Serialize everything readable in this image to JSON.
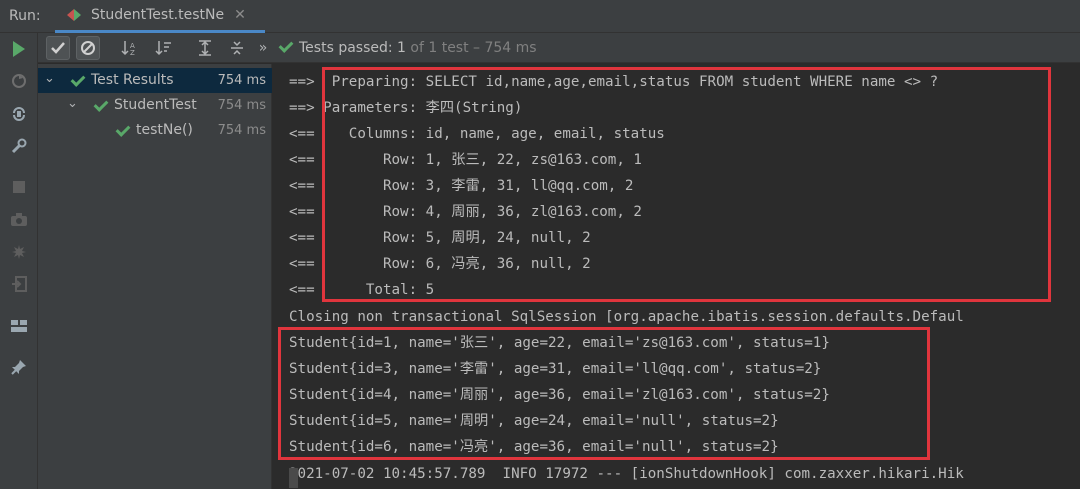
{
  "topbar": {
    "run_label": "Run:",
    "tab_title": "StudentTest.testNe",
    "tab_close": "✕"
  },
  "toolbar": {
    "status_bold": "Tests passed:",
    "status_count": " 1",
    "status_rest": " of 1 test – 754 ms",
    "more": "»"
  },
  "tree": {
    "items": [
      {
        "label": "Test Results",
        "time": "754 ms"
      },
      {
        "label": "StudentTest",
        "time": "754 ms"
      },
      {
        "label": "testNe()",
        "time": "754 ms"
      }
    ]
  },
  "console": {
    "lines": [
      "==>  Preparing: SELECT id,name,age,email,status FROM student WHERE name <> ?",
      "==> Parameters: 李四(String)",
      "<==    Columns: id, name, age, email, status",
      "<==        Row: 1, 张三, 22, zs@163.com, 1",
      "<==        Row: 3, 李雷, 31, ll@qq.com, 2",
      "<==        Row: 4, 周丽, 36, zl@163.com, 2",
      "<==        Row: 5, 周明, 24, null, 2",
      "<==        Row: 6, 冯亮, 36, null, 2",
      "<==      Total: 5",
      "Closing non transactional SqlSession [org.apache.ibatis.session.defaults.Defaul",
      "Student{id=1, name='张三', age=22, email='zs@163.com', status=1}",
      "Student{id=3, name='李雷', age=31, email='ll@qq.com', status=2}",
      "Student{id=4, name='周丽', age=36, email='zl@163.com', status=2}",
      "Student{id=5, name='周明', age=24, email='null', status=2}",
      "Student{id=6, name='冯亮', age=36, email='null', status=2}",
      "2021-07-02 10:45:57.789  INFO 17972 --- [ionShutdownHook] com.zaxxer.hikari.Hik"
    ]
  },
  "colors": {
    "pass_green": "#59a869",
    "highlight_red": "#e0353d",
    "selection": "#0d293e",
    "tab_underline": "#4a88c7"
  }
}
